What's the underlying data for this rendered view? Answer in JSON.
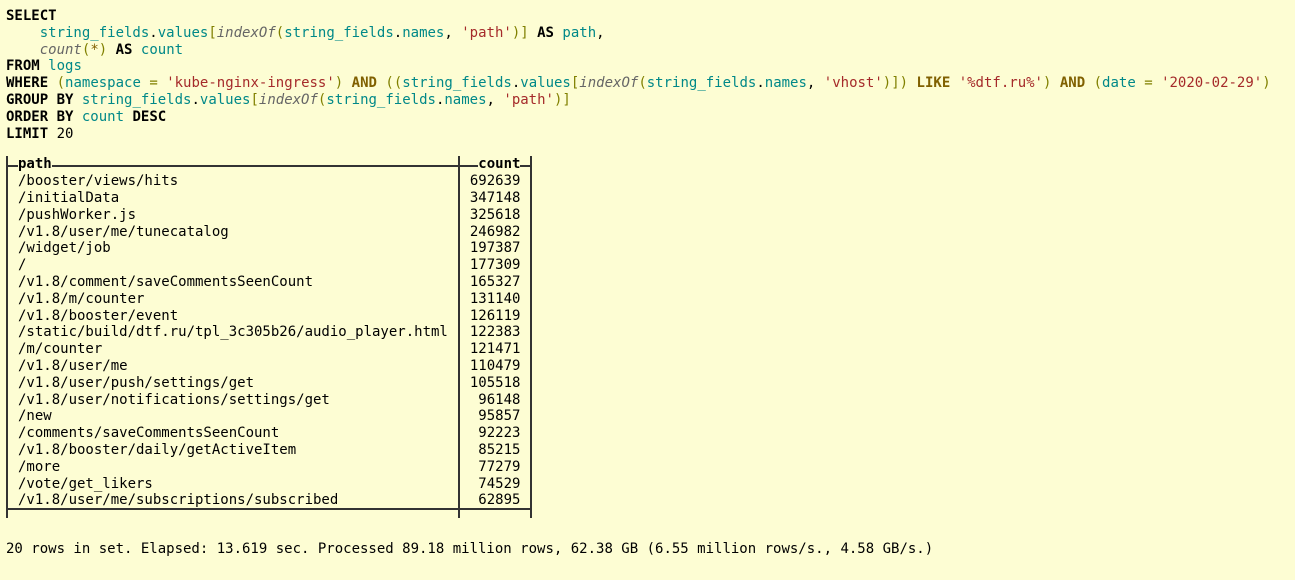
{
  "sql": {
    "select": "SELECT",
    "l2_field": "string_fields",
    "dot": ".",
    "values": "values",
    "ob": "[",
    "cb": "]",
    "indexOf": "indexOf",
    "op": "(",
    "cp": ")",
    "names": "names",
    "comma": ", ",
    "relpath": "'path'",
    "as": "AS",
    "alias_path": "path",
    "count": "count",
    "star": "*",
    "alias_count": "count",
    "from": "FROM",
    "logs": "logs",
    "where": "WHERE",
    "namespace": "namespace",
    "eq": "=",
    "ns_val": "'kube-nginx-ingress'",
    "and": "AND",
    "vhost": "'vhost'",
    "like": "LIKE",
    "like_val": "'%dtf.ru%'",
    "date": "date",
    "date_val": "'2020-02-29'",
    "groupby": "GROUP BY",
    "orderby": "ORDER BY",
    "desc": "DESC",
    "limit": "LIMIT",
    "limit_n": "20"
  },
  "columns": {
    "path": "path",
    "count": "count"
  },
  "rows": [
    {
      "path": "/booster/views/hits",
      "count": "692639"
    },
    {
      "path": "/initialData",
      "count": "347148"
    },
    {
      "path": "/pushWorker.js",
      "count": "325618"
    },
    {
      "path": "/v1.8/user/me/tunecatalog",
      "count": "246982"
    },
    {
      "path": "/widget/job",
      "count": "197387"
    },
    {
      "path": "/",
      "count": "177309"
    },
    {
      "path": "/v1.8/comment/saveCommentsSeenCount",
      "count": "165327"
    },
    {
      "path": "/v1.8/m/counter",
      "count": "131140"
    },
    {
      "path": "/v1.8/booster/event",
      "count": "126119"
    },
    {
      "path": "/static/build/dtf.ru/tpl_3c305b26/audio_player.html",
      "count": "122383"
    },
    {
      "path": "/m/counter",
      "count": "121471"
    },
    {
      "path": "/v1.8/user/me",
      "count": "110479"
    },
    {
      "path": "/v1.8/user/push/settings/get",
      "count": "105518"
    },
    {
      "path": "/v1.8/user/notifications/settings/get",
      "count": "96148"
    },
    {
      "path": "/new",
      "count": "95857"
    },
    {
      "path": "/comments/saveCommentsSeenCount",
      "count": "92223"
    },
    {
      "path": "/v1.8/booster/daily/getActiveItem",
      "count": "85215"
    },
    {
      "path": "/more",
      "count": "77279"
    },
    {
      "path": "/vote/get_likers",
      "count": "74529"
    },
    {
      "path": "/v1.8/user/me/subscriptions/subscribed",
      "count": "62895"
    }
  ],
  "footer": "20 rows in set. Elapsed: 13.619 sec. Processed 89.18 million rows, 62.38 GB (6.55 million rows/s., 4.58 GB/s.)",
  "chart_data": {
    "type": "table",
    "columns": [
      "path",
      "count"
    ],
    "rows": [
      [
        "/booster/views/hits",
        692639
      ],
      [
        "/initialData",
        347148
      ],
      [
        "/pushWorker.js",
        325618
      ],
      [
        "/v1.8/user/me/tunecatalog",
        246982
      ],
      [
        "/widget/job",
        197387
      ],
      [
        "/",
        177309
      ],
      [
        "/v1.8/comment/saveCommentsSeenCount",
        165327
      ],
      [
        "/v1.8/m/counter",
        131140
      ],
      [
        "/v1.8/booster/event",
        126119
      ],
      [
        "/static/build/dtf.ru/tpl_3c305b26/audio_player.html",
        122383
      ],
      [
        "/m/counter",
        121471
      ],
      [
        "/v1.8/user/me",
        110479
      ],
      [
        "/v1.8/user/push/settings/get",
        105518
      ],
      [
        "/v1.8/user/notifications/settings/get",
        96148
      ],
      [
        "/new",
        95857
      ],
      [
        "/comments/saveCommentsSeenCount",
        92223
      ],
      [
        "/v1.8/booster/daily/getActiveItem",
        85215
      ],
      [
        "/more",
        77279
      ],
      [
        "/vote/get_likers",
        74529
      ],
      [
        "/v1.8/user/me/subscriptions/subscribed",
        62895
      ]
    ]
  }
}
